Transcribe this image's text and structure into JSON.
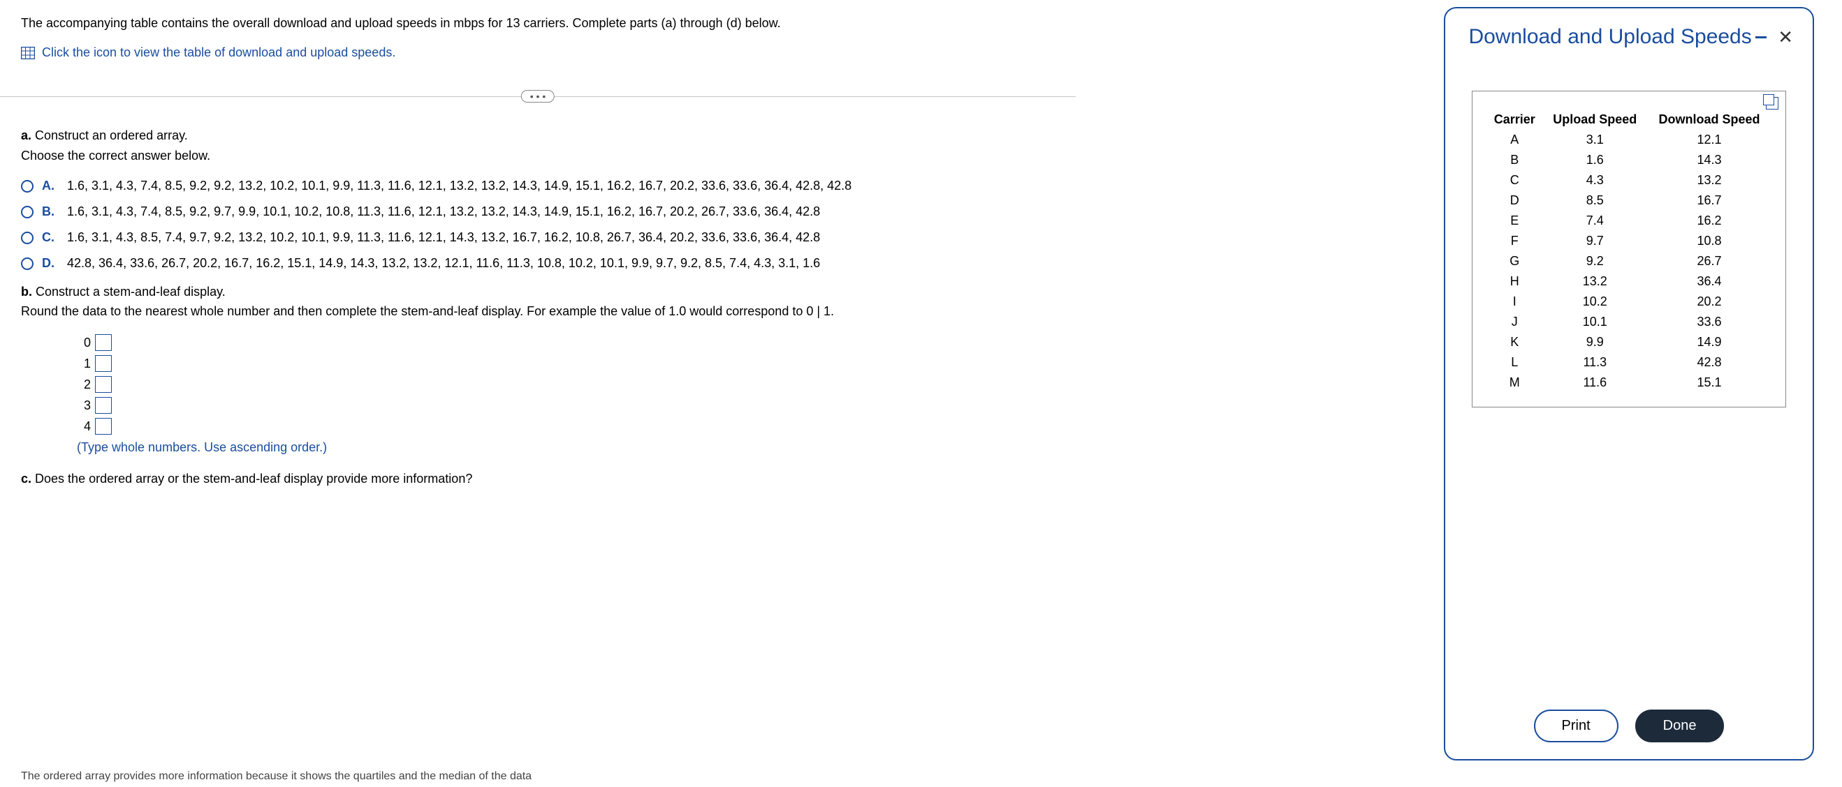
{
  "intro": "The accompanying table contains the overall download and upload speeds in mbps for 13 carriers. Complete parts (a) through (d) below.",
  "iconLinkText": "Click the icon to view the table of download and upload speeds.",
  "ellipsis": "• • •",
  "partA": {
    "prefix": "a.",
    "prompt": "Construct an ordered array.",
    "instruction": "Choose the correct answer below."
  },
  "options": [
    {
      "letter": "A.",
      "text": "1.6, 3.1, 4.3, 7.4, 8.5, 9.2, 9.2, 13.2, 10.2, 10.1, 9.9, 11.3, 11.6, 12.1, 13.2, 13.2, 14.3, 14.9, 15.1, 16.2, 16.7, 20.2, 33.6, 33.6, 36.4, 42.8, 42.8"
    },
    {
      "letter": "B.",
      "text": "1.6, 3.1, 4.3, 7.4, 8.5, 9.2, 9.7, 9.9, 10.1, 10.2, 10.8, 11.3, 11.6, 12.1, 13.2, 13.2, 14.3, 14.9, 15.1, 16.2, 16.7, 20.2, 26.7, 33.6, 36.4, 42.8"
    },
    {
      "letter": "C.",
      "text": "1.6, 3.1, 4.3, 8.5, 7.4, 9.7, 9.2, 13.2, 10.2, 10.1, 9.9, 11.3, 11.6, 12.1, 14.3, 13.2, 16.7, 16.2, 10.8, 26.7, 36.4, 20.2, 33.6, 33.6, 36.4, 42.8"
    },
    {
      "letter": "D.",
      "text": "42.8, 36.4, 33.6, 26.7, 20.2, 16.7, 16.2, 15.1, 14.9, 14.3, 13.2, 13.2, 12.1, 11.6, 11.3, 10.8, 10.2, 10.1, 9.9, 9.7, 9.2, 8.5, 7.4, 4.3, 3.1, 1.6"
    }
  ],
  "partB": {
    "prefix": "b.",
    "prompt": "Construct a stem-and-leaf display.",
    "instruction": "Round the data to the nearest whole number and then complete the stem-and-leaf display. For example the value of 1.0 would correspond to 0 | 1."
  },
  "stems": [
    "0",
    "1",
    "2",
    "3",
    "4"
  ],
  "helper": "(Type whole numbers. Use ascending order.)",
  "partC": {
    "prefix": "c.",
    "prompt": "Does the ordered array or the stem-and-leaf display provide more information?"
  },
  "cutoffLine": "The ordered array provides more information because it shows the quartiles and the median of the data",
  "popup": {
    "title": "Download and Upload Speeds",
    "headers": {
      "carrier": "Carrier",
      "upload": "Upload Speed",
      "download": "Download Speed"
    },
    "rows": [
      {
        "c": "A",
        "u": "3.1",
        "d": "12.1"
      },
      {
        "c": "B",
        "u": "1.6",
        "d": "14.3"
      },
      {
        "c": "C",
        "u": "4.3",
        "d": "13.2"
      },
      {
        "c": "D",
        "u": "8.5",
        "d": "16.7"
      },
      {
        "c": "E",
        "u": "7.4",
        "d": "16.2"
      },
      {
        "c": "F",
        "u": "9.7",
        "d": "10.8"
      },
      {
        "c": "G",
        "u": "9.2",
        "d": "26.7"
      },
      {
        "c": "H",
        "u": "13.2",
        "d": "36.4"
      },
      {
        "c": "I",
        "u": "10.2",
        "d": "20.2"
      },
      {
        "c": "J",
        "u": "10.1",
        "d": "33.6"
      },
      {
        "c": "K",
        "u": "9.9",
        "d": "14.9"
      },
      {
        "c": "L",
        "u": "11.3",
        "d": "42.8"
      },
      {
        "c": "M",
        "u": "11.6",
        "d": "15.1"
      }
    ],
    "printLabel": "Print",
    "doneLabel": "Done"
  }
}
